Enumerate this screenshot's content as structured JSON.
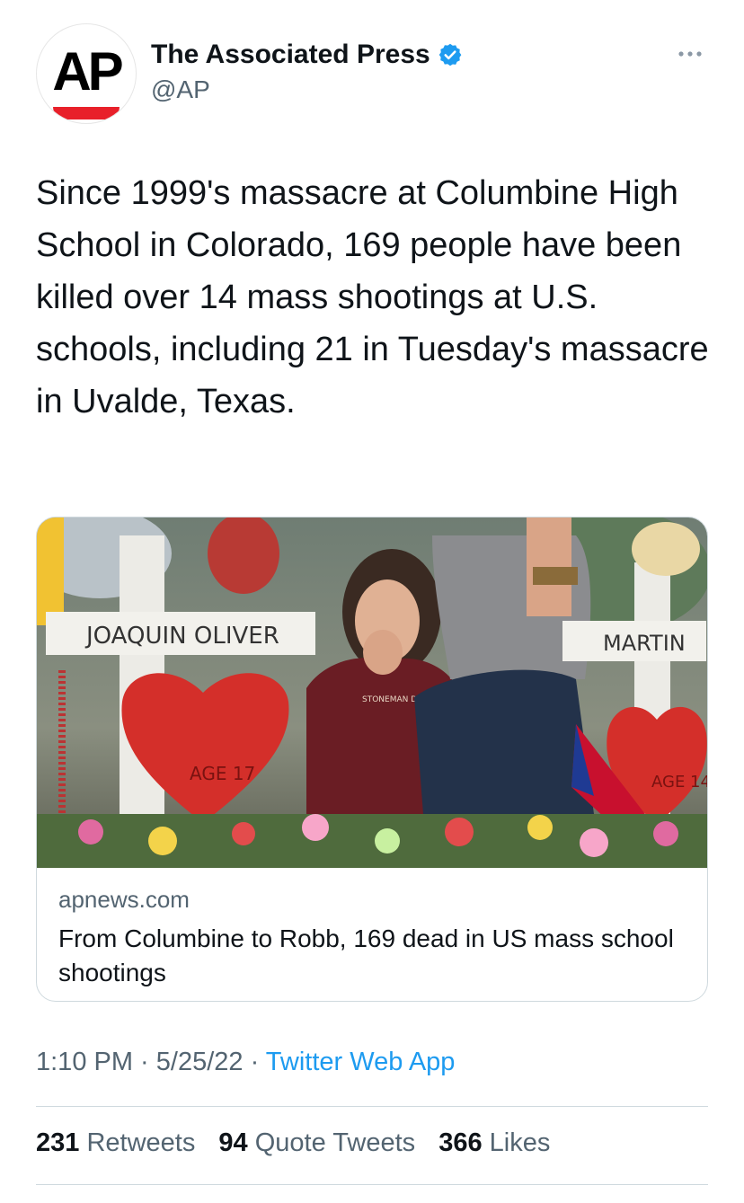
{
  "author": {
    "display_name": "The Associated Press",
    "handle": "@AP",
    "avatar_text": "AP",
    "verified": true
  },
  "tweet": {
    "text": "Since 1999's massacre at Columbine High School in Colorado, 169 people have been killed over 14 mass shootings at U.S. schools, including 21 in Tuesday's massacre in Uvalde, Texas."
  },
  "card": {
    "domain": "apnews.com",
    "title": "From Columbine to Robb, 169 dead in US mass school shootings",
    "image_description": "Memorial of crosses and hearts with a woman covering her mouth",
    "image_texts": {
      "cross_left": "JOAQUIN OLIVER",
      "cross_right": "MARTIN",
      "heart_left": "AGE 17",
      "heart_right": "AGE 14",
      "shirt": "STONEMAN DOUGLAS HIGH SCHOOL"
    }
  },
  "meta": {
    "time": "1:10 PM",
    "sep1": " · ",
    "date": "5/25/22",
    "sep2": " · ",
    "source": "Twitter Web App"
  },
  "stats": {
    "retweets_count": "231",
    "retweets_label": "Retweets",
    "quotes_count": "94",
    "quotes_label": "Quote Tweets",
    "likes_count": "366",
    "likes_label": "Likes"
  },
  "colors": {
    "accent": "#1d9bf0",
    "text": "#0f1419",
    "secondary": "#536471",
    "ap_red": "#e8202a"
  },
  "icons": [
    "verified-badge-icon",
    "more-options-icon"
  ]
}
